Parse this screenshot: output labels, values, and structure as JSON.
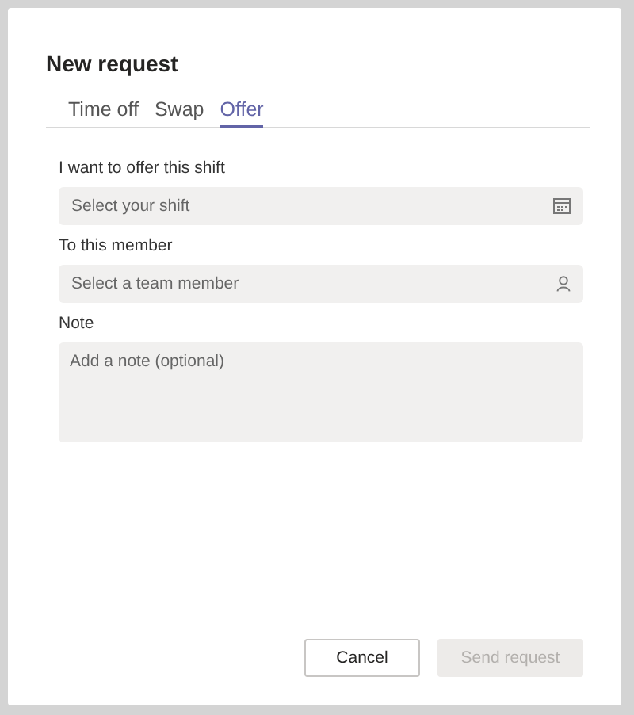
{
  "dialog": {
    "title": "New request"
  },
  "tabs": [
    {
      "label": "Time off",
      "selected": false
    },
    {
      "label": "Swap",
      "selected": false
    },
    {
      "label": "Offer",
      "selected": true
    }
  ],
  "fields": [
    {
      "label": "I want to offer this shift",
      "placeholder": "Select your shift",
      "kind": "date"
    },
    {
      "label": "To this member",
      "placeholder": "Select a team member",
      "kind": "person"
    },
    {
      "label": "Note",
      "placeholder": "Add a note (optional)",
      "kind": "note"
    }
  ],
  "buttons": [
    {
      "label": "Cancel",
      "disabled": false
    },
    {
      "label": "Send request",
      "disabled": true
    }
  ]
}
